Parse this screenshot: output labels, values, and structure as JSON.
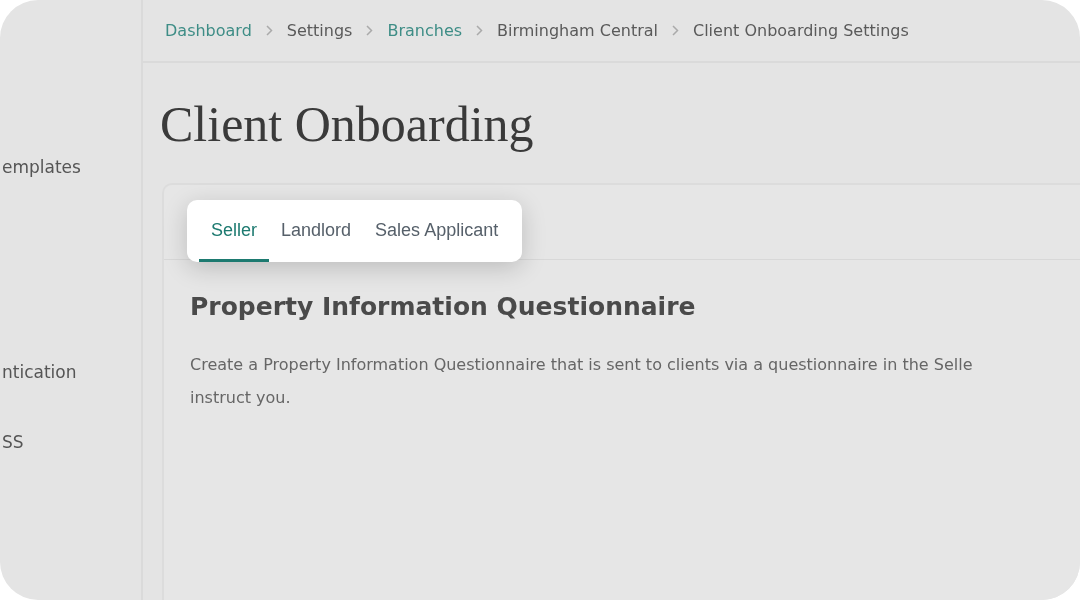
{
  "sidebar": {
    "items": [
      {
        "label": "emplates"
      },
      {
        "label": "ntication"
      },
      {
        "label": "SS"
      }
    ]
  },
  "breadcrumb": [
    {
      "label": "Dashboard",
      "link": true
    },
    {
      "label": "Settings",
      "link": false
    },
    {
      "label": "Branches",
      "link": true
    },
    {
      "label": "Birmingham Central",
      "link": false
    },
    {
      "label": "Client Onboarding Settings",
      "link": false
    }
  ],
  "page_title": "Client Onboarding",
  "tabs": [
    {
      "label": "Seller",
      "selected": true
    },
    {
      "label": "Landlord",
      "selected": false
    },
    {
      "label": "Sales Applicant",
      "selected": false
    }
  ],
  "section": {
    "title": "Property Information Questionnaire",
    "description_lines": [
      "Create a Property Information Questionnaire that is sent to clients via a questionnaire in the Selle",
      "instruct you."
    ]
  }
}
